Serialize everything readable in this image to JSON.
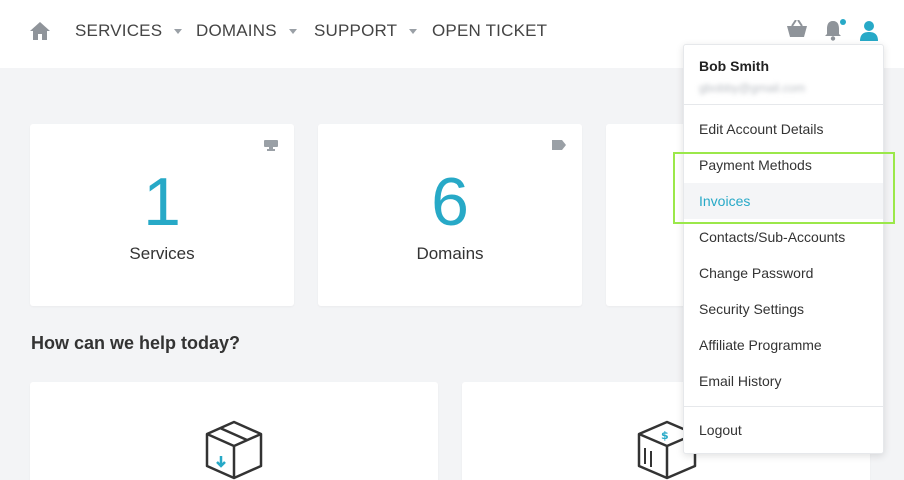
{
  "nav": {
    "items": [
      {
        "label": "SERVICES",
        "has_caret": true
      },
      {
        "label": "DOMAINS",
        "has_caret": true
      },
      {
        "label": "SUPPORT",
        "has_caret": true
      },
      {
        "label": "OPEN TICKET",
        "has_caret": false
      }
    ],
    "icons": [
      "home-icon",
      "cart-icon",
      "bell-icon",
      "user-icon"
    ],
    "accent_color": "#27a9c7"
  },
  "stats": [
    {
      "value": "1",
      "label": "Services",
      "icon": "monitor-icon"
    },
    {
      "value": "6",
      "label": "Domains",
      "icon": "tag-icon"
    }
  ],
  "help": {
    "heading": "How can we help today?",
    "cards": [
      {
        "icon": "box-download-icon"
      },
      {
        "icon": "dollar-boxes-icon"
      }
    ]
  },
  "account_menu": {
    "name": "Bob Smith",
    "email": "gbobby@gmail.com",
    "items": [
      "Edit Account Details",
      "Payment Methods",
      "Invoices",
      "Contacts/Sub-Accounts",
      "Change Password",
      "Security Settings",
      "Affiliate Programme",
      "Email History"
    ],
    "active_item": "Invoices",
    "logout": "Logout",
    "highlight_color": "#9be84a"
  }
}
